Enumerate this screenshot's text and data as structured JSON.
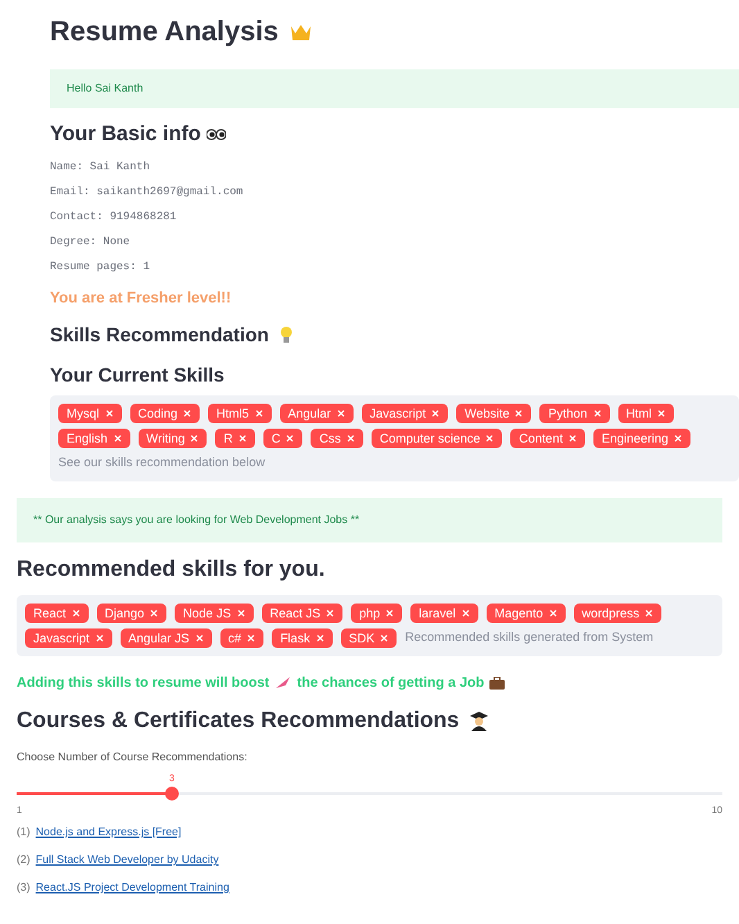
{
  "title": "Resume Analysis",
  "greeting": "Hello Sai Kanth",
  "basic_info": {
    "heading": "Your Basic info",
    "lines": [
      "Name: Sai Kanth",
      "Email: saikanth2697@gmail.com",
      "Contact: 9194868281",
      "Degree: None",
      "Resume pages: 1"
    ]
  },
  "level_message": "You are at Fresher level!!",
  "skills_heading": "Skills Recommendation",
  "current_skills": {
    "heading": "Your Current Skills",
    "tags": [
      "Mysql",
      "Coding",
      "Html5",
      "Angular",
      "Javascript",
      "Website",
      "Python",
      "Html",
      "English",
      "Writing",
      "R",
      "C",
      "Css",
      "Computer science",
      "Content",
      "Engineering"
    ],
    "hint": "See our skills recommendation below"
  },
  "analysis_message": "** Our analysis says you are looking for Web Development Jobs **",
  "recommended": {
    "heading": "Recommended skills for you.",
    "tags": [
      "React",
      "Django",
      "Node JS",
      "React JS",
      "php",
      "laravel",
      "Magento",
      "wordpress",
      "Javascript",
      "Angular JS",
      "c#",
      "Flask",
      "SDK"
    ],
    "hint": "Recommended skills generated from System"
  },
  "boost_message": {
    "before": "Adding this skills to resume will boost",
    "after": "the chances of getting a Job"
  },
  "courses": {
    "heading": "Courses & Certificates Recommendations",
    "slider": {
      "label": "Choose Number of Course Recommendations:",
      "value": "3",
      "min": "1",
      "max": "10",
      "level": 0.22
    },
    "items": [
      {
        "number": "(1)",
        "title": "Node.js and Express.js [Free]"
      },
      {
        "number": "(2)",
        "title": "Full Stack Web Developer by Udacity"
      },
      {
        "number": "(3)",
        "title": "React.JS Project Development Training"
      }
    ]
  }
}
